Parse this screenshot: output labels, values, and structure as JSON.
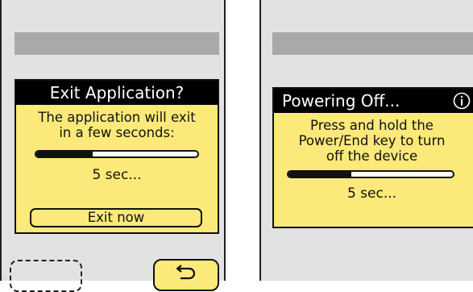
{
  "exit_dialog": {
    "title": "Exit Application?",
    "message_line1": "The application will exit",
    "message_line2": "in a few seconds:",
    "progress": 0.35,
    "countdown": "5 sec...",
    "exit_button_label": "Exit now"
  },
  "softkeys": {
    "back_icon": "back-arrow-icon"
  },
  "power_dialog": {
    "title": "Powering Off...",
    "info_icon": "info-icon",
    "message_line1": "Press and hold the",
    "message_line2": "Power/End key to turn",
    "message_line3": "off the device",
    "progress": 0.38,
    "countdown": "5 sec..."
  },
  "colors": {
    "dialog_background": "#fbe97a",
    "title_background": "#000000",
    "screen_background": "#e2e2e2",
    "header_bar": "#a9a9a9"
  }
}
